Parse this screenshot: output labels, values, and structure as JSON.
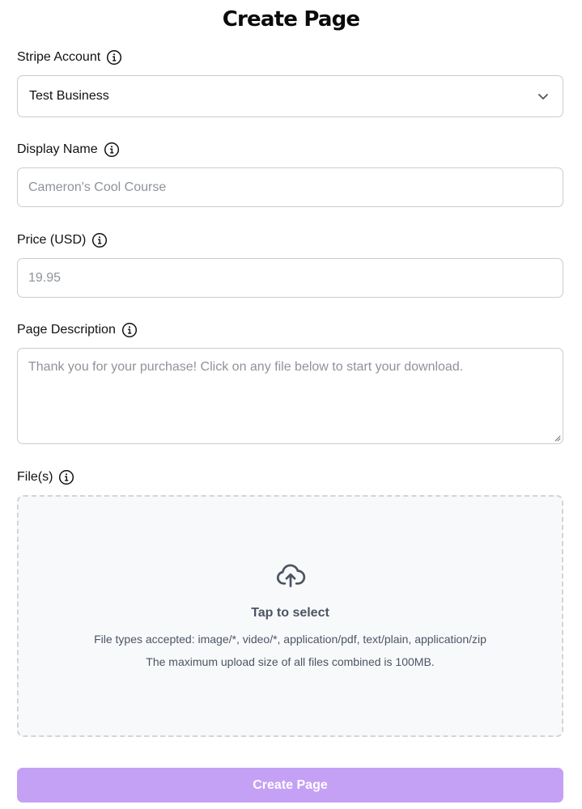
{
  "page": {
    "title": "Create Page"
  },
  "colors": {
    "accent": "#c4a1f5",
    "border": "#c9ccd2",
    "placeholder": "#8e939b",
    "dropzone_bg": "#f8f9fb"
  },
  "form": {
    "stripe_account": {
      "label": "Stripe Account",
      "value": "Test Business",
      "icon": "info-circle-icon"
    },
    "display_name": {
      "label": "Display Name",
      "value": "",
      "placeholder": "Cameron's Cool Course",
      "icon": "info-circle-icon"
    },
    "price": {
      "label": "Price (USD)",
      "value": "",
      "placeholder": "19.95",
      "icon": "info-circle-icon"
    },
    "description": {
      "label": "Page Description",
      "value": "",
      "placeholder": "Thank you for your purchase! Click on any file below to start your download.",
      "icon": "info-circle-icon"
    },
    "files": {
      "label": "File(s)",
      "icon": "info-circle-icon",
      "upload_icon": "cloud-upload-icon",
      "prompt": "Tap to select",
      "accepted": "File types accepted: image/*, video/*, application/pdf, text/plain, application/zip",
      "max_size": "The maximum upload size of all files combined is 100MB."
    },
    "submit_label": "Create Page"
  }
}
